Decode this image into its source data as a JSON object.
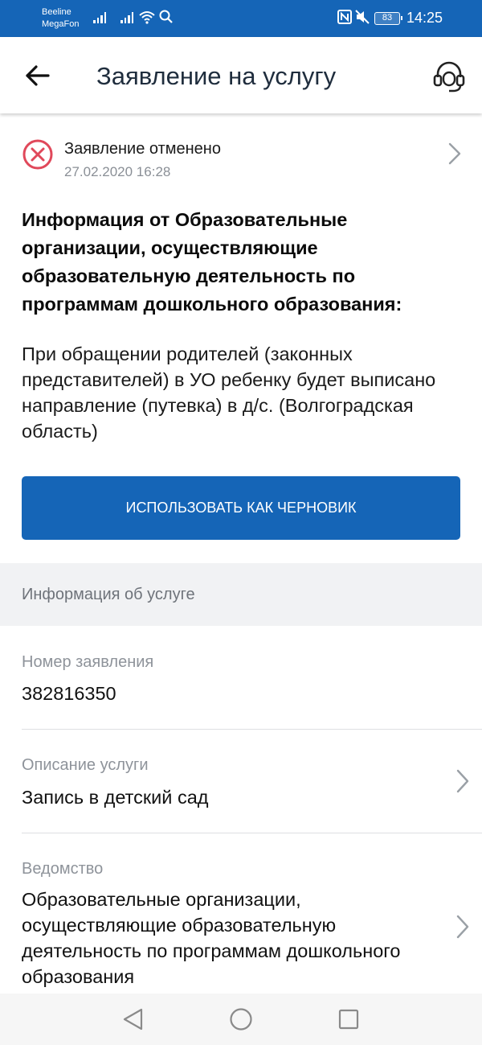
{
  "status_bar": {
    "carrier_1": "Beeline",
    "carrier_2": "MegaFon",
    "battery": "83",
    "time": "14:25"
  },
  "app_bar": {
    "title": "Заявление на услугу",
    "back_icon": "arrow-left-icon",
    "support_icon": "headset-icon"
  },
  "status": {
    "icon": "cancel-circle-icon",
    "text": "Заявление отменено",
    "date": "27.02.2020 16:28"
  },
  "info": {
    "title": "Информация от Образовательные организации, осуществляющие образовательную деятельность по программам дошкольного образования:",
    "body": "При обращении родителей (законных представителей) в УО ребенку будет выписано направление (путевка) в д/с. (Волгоградская область)"
  },
  "actions": {
    "draft_label": "ИСПОЛЬЗОВАТЬ КАК ЧЕРНОВИК"
  },
  "service_info": {
    "header": "Информация об услуге",
    "fields": [
      {
        "label": "Номер заявления",
        "value": "382816350"
      },
      {
        "label": "Описание услуги",
        "value": "Запись в детский сад"
      },
      {
        "label": "Ведомство",
        "value": "Образовательные организации, осуществляющие образовательную деятельность по программам дошкольного образования"
      }
    ]
  },
  "colors": {
    "primary": "#1565b7",
    "cancel": "#e0485a",
    "section_bg": "#f1f2f4"
  }
}
